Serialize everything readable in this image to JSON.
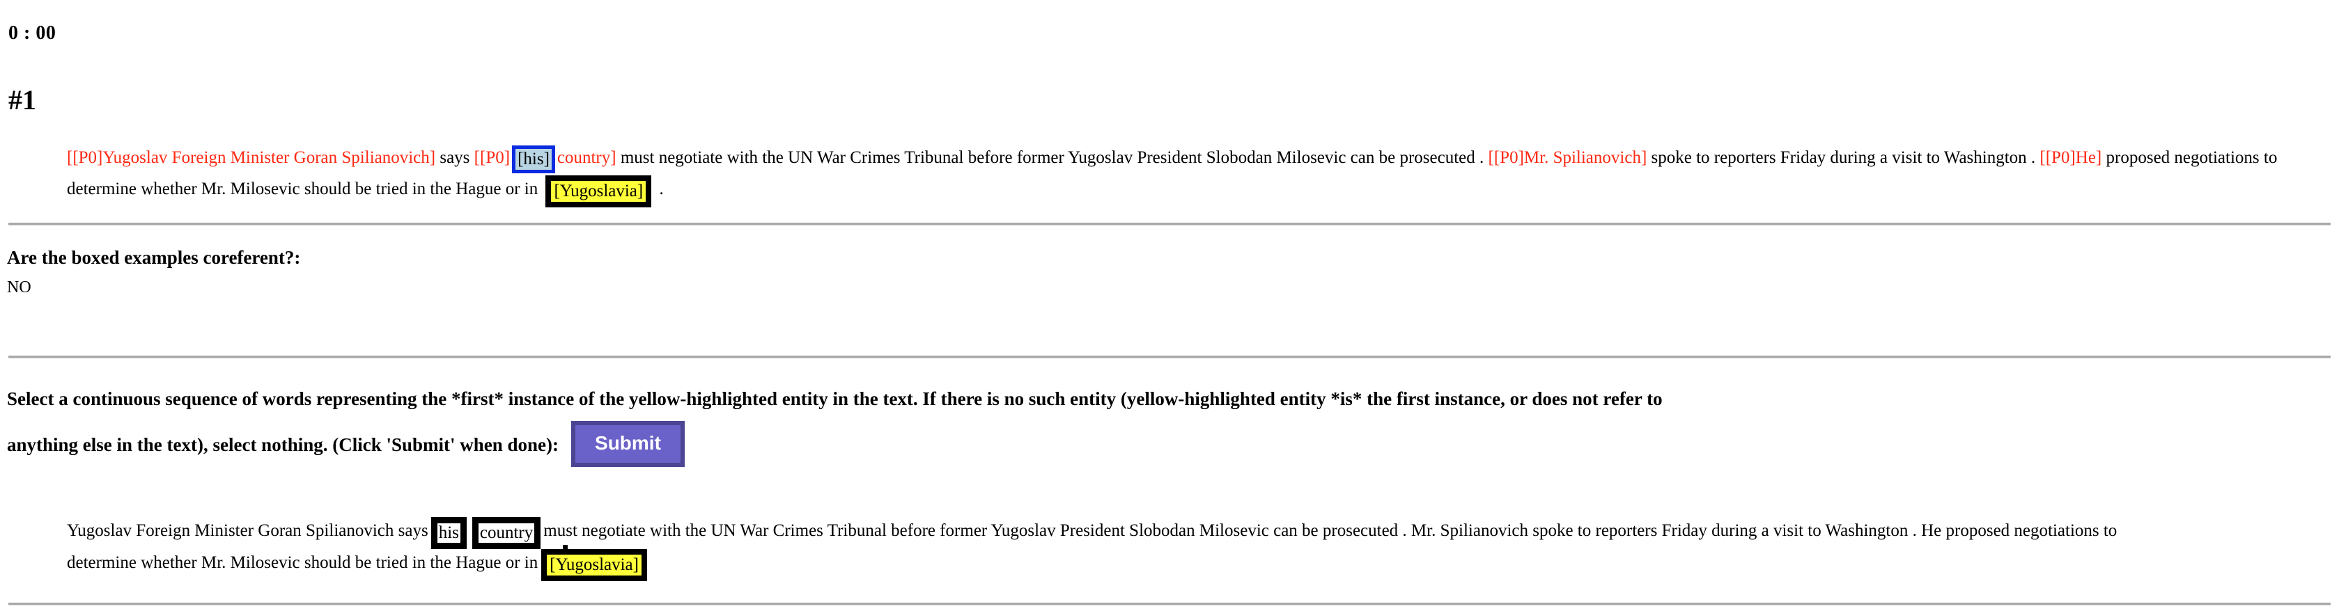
{
  "timer": "0 : 00",
  "task_number": "#1",
  "colors": {
    "coref_text": "#ff2a15",
    "mention_blue_border": "#0a2be0",
    "mention_blue_fill": "#b9d4e2",
    "highlight_yellow": "#ffff3a",
    "token_box_border": "#000000",
    "submit_fill": "#6a62c8",
    "submit_border": "#4b4593",
    "divider": "#a8a8a8"
  },
  "annotated_passage": {
    "segments": [
      {
        "text": "[[P0]Yugoslav Foreign Minister Goran Spilianovich]",
        "style": "coref"
      },
      {
        "text": " says ",
        "style": "plain"
      },
      {
        "text": "[[P0]",
        "style": "coref"
      },
      {
        "text": "[his]",
        "style": "mention-blue"
      },
      {
        "text": "country]",
        "style": "coref"
      },
      {
        "text": " must negotiate with the UN War Crimes Tribunal before former Yugoslav President Slobodan Milosevic can be prosecuted . ",
        "style": "plain"
      },
      {
        "text": "[[P0]Mr. Spilianovich]",
        "style": "coref"
      },
      {
        "text": " spoke to reporters Friday during a visit to Washington . ",
        "style": "plain"
      },
      {
        "text": "[[P0]He]",
        "style": "coref"
      },
      {
        "text": " proposed negotiations to determine whether Mr. Milosevic should be tried in the Hague or in ",
        "style": "plain"
      },
      {
        "text": "[Yugoslavia]",
        "style": "mention-yellow"
      },
      {
        "text": " .",
        "style": "plain"
      }
    ]
  },
  "question": {
    "label": "Are the boxed examples coreferent?:",
    "answer": "NO"
  },
  "instructions": {
    "line1": "Select a continuous sequence of words representing the *first* instance of the yellow-highlighted entity in the text. If there is no such entity (yellow-highlighted entity *is* the first instance, or does not refer to",
    "line2": "anything else in the text), select nothing. (Click 'Submit' when done):",
    "submit_label": "Submit"
  },
  "selection_passage": {
    "segments": [
      {
        "text": "Yugoslav Foreign Minister Goran Spilianovich says",
        "style": "plain"
      },
      {
        "text": "his",
        "style": "token-box"
      },
      {
        "text": "country",
        "style": "token-box"
      },
      {
        "text": "must negotiate with the UN War Crimes Tribunal before former Yugoslav President Slobodan Milosevic can be prosecuted . Mr. Spilianovich spoke to reporters Friday during a visit to Washington . He proposed negotiations to determine whether Mr. Milosevic should be tried in the Hague or in",
        "style": "plain"
      },
      {
        "text": "[Yugoslavia]",
        "style": "mention-yellow"
      }
    ]
  }
}
